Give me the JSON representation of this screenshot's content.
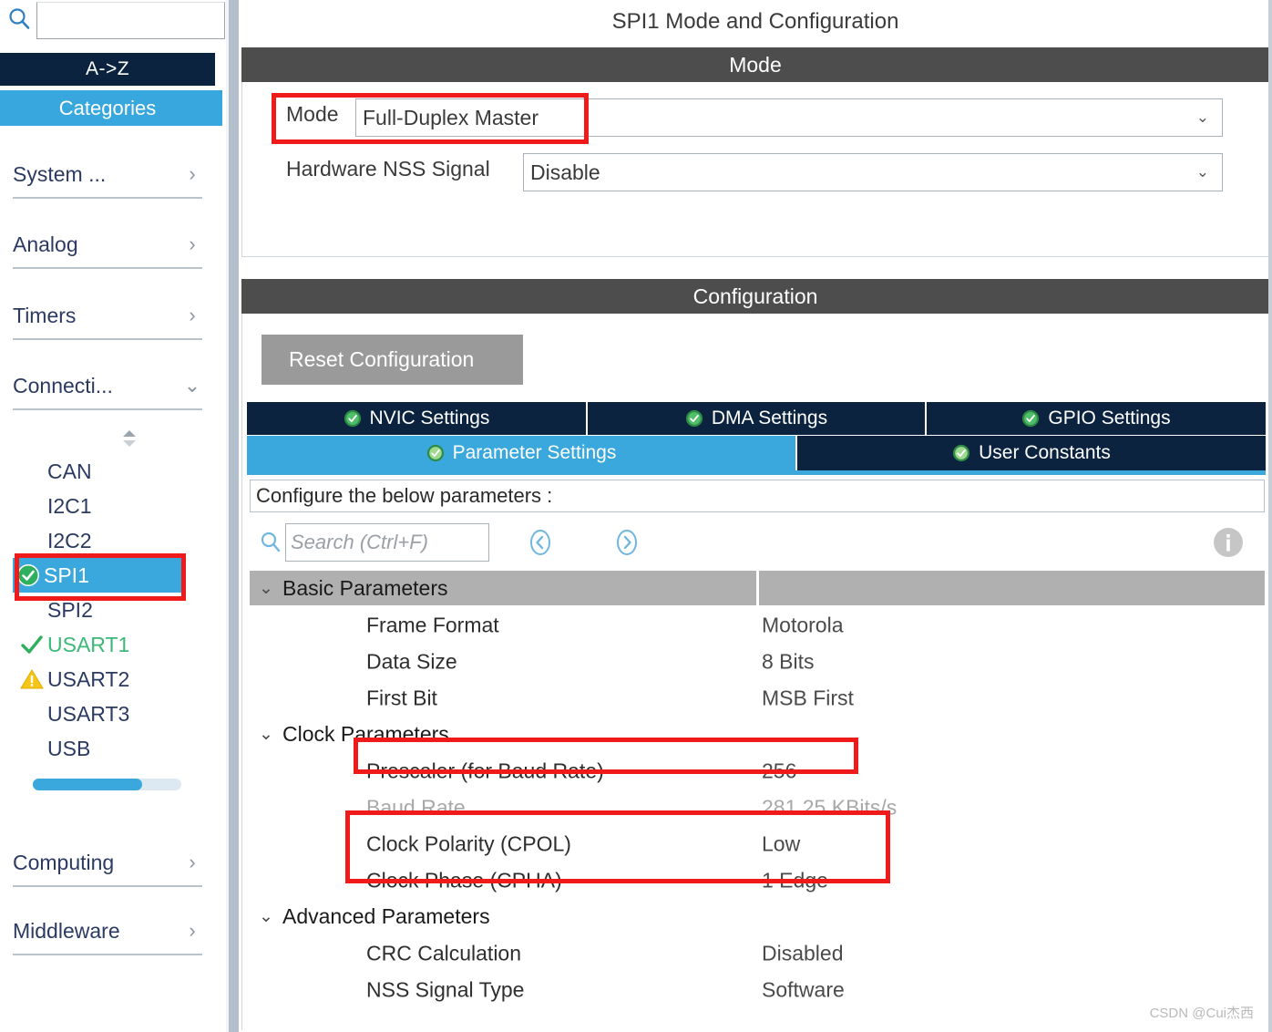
{
  "sidebar": {
    "search": {
      "value": "",
      "placeholder": "",
      "icon": "search-icon"
    },
    "sort_tab": "A->Z",
    "categories_tab": "Categories",
    "categories": [
      {
        "label": "System ...",
        "chevron": "›"
      },
      {
        "label": "Analog",
        "chevron": "›"
      },
      {
        "label": "Timers",
        "chevron": "›"
      },
      {
        "label": "Connecti...",
        "chevron": "⌄"
      }
    ],
    "categories_bottom": [
      {
        "label": "Computing",
        "chevron": "›"
      },
      {
        "label": "Middleware",
        "chevron": "›"
      }
    ],
    "peripherals": [
      {
        "label": "CAN",
        "status": "none"
      },
      {
        "label": "I2C1",
        "status": "none"
      },
      {
        "label": "I2C2",
        "status": "none"
      },
      {
        "label": "SPI1",
        "status": "configured",
        "selected": true
      },
      {
        "label": "SPI2",
        "status": "none"
      },
      {
        "label": "USART1",
        "status": "check"
      },
      {
        "label": "USART2",
        "status": "warning"
      },
      {
        "label": "USART3",
        "status": "none"
      },
      {
        "label": "USB",
        "status": "none"
      }
    ]
  },
  "main": {
    "title": "SPI1 Mode and Configuration",
    "mode_section": {
      "header": "Mode",
      "rows": [
        {
          "label": "Mode",
          "value": "Full-Duplex Master"
        },
        {
          "label": "Hardware NSS Signal",
          "value": "Disable"
        }
      ]
    },
    "configuration_section": {
      "header": "Configuration",
      "reset_button": "Reset Configuration",
      "tabs_row1": [
        {
          "label": "NVIC Settings",
          "active": false
        },
        {
          "label": "DMA Settings",
          "active": false
        },
        {
          "label": "GPIO Settings",
          "active": false
        }
      ],
      "tabs_row2": [
        {
          "label": "Parameter Settings",
          "active": true
        },
        {
          "label": "User Constants",
          "active": false
        }
      ],
      "configure_note": "Configure the below parameters :",
      "param_search_placeholder": "Search (Ctrl+F)",
      "param_search_value": "",
      "nav_prev": "‹",
      "nav_next": "›",
      "groups": [
        {
          "name": "Basic Parameters",
          "shaded": true,
          "rows": [
            {
              "name": "Frame Format",
              "value": "Motorola",
              "dim": false
            },
            {
              "name": "Data Size",
              "value": "8 Bits",
              "dim": false
            },
            {
              "name": "First Bit",
              "value": "MSB First",
              "dim": false
            }
          ]
        },
        {
          "name": "Clock Parameters",
          "shaded": false,
          "rows": [
            {
              "name": "Prescaler (for Baud Rate)",
              "value": "256",
              "dim": false
            },
            {
              "name": "Baud Rate",
              "value": "281.25 KBits/s",
              "dim": true
            },
            {
              "name": "Clock Polarity (CPOL)",
              "value": "Low",
              "dim": false
            },
            {
              "name": "Clock Phase (CPHA)",
              "value": "1 Edge",
              "dim": false
            }
          ]
        },
        {
          "name": "Advanced Parameters",
          "shaded": false,
          "rows": [
            {
              "name": "CRC Calculation",
              "value": "Disabled",
              "dim": false
            },
            {
              "name": "NSS Signal Type",
              "value": "Software",
              "dim": false
            }
          ]
        }
      ]
    }
  },
  "watermark": "CSDN @Cui杰西",
  "colors": {
    "accent_blue": "#3aa8dd",
    "dark_navy": "#0c2340",
    "section_header_gray": "#4d4d4d",
    "highlight_red": "#ef1b1b",
    "ok_green": "#3cb878",
    "warning_yellow": "#f5c518",
    "group_band_gray": "#b0b0b0"
  }
}
